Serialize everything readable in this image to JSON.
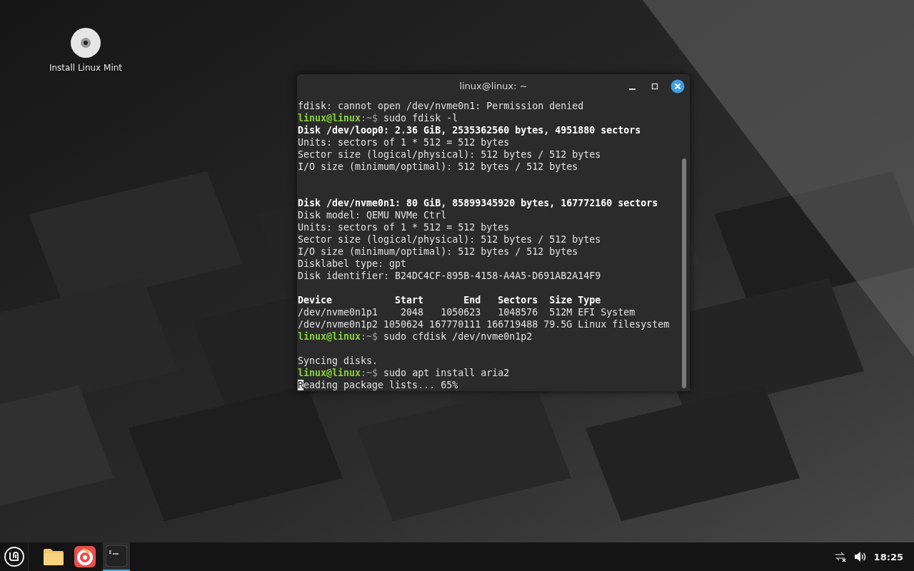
{
  "desktop": {
    "icons": [
      {
        "label": "Install Linux Mint"
      }
    ]
  },
  "terminal": {
    "title": "linux@linux: ~",
    "lines": [
      {
        "kind": "output",
        "text": "fdisk: cannot open /dev/nvme0n1: Permission denied"
      },
      {
        "kind": "prompt",
        "user": "linux@linux",
        "path": ":~$",
        "command": " sudo fdisk -l"
      },
      {
        "kind": "bold",
        "text": "Disk /dev/loop0: 2.36 GiB, 2535362560 bytes, 4951880 sectors"
      },
      {
        "kind": "output",
        "text": "Units: sectors of 1 * 512 = 512 bytes"
      },
      {
        "kind": "output",
        "text": "Sector size (logical/physical): 512 bytes / 512 bytes"
      },
      {
        "kind": "output",
        "text": "I/O size (minimum/optimal): 512 bytes / 512 bytes"
      },
      {
        "kind": "blank"
      },
      {
        "kind": "blank"
      },
      {
        "kind": "bold",
        "text": "Disk /dev/nvme0n1: 80 GiB, 85899345920 bytes, 167772160 sectors"
      },
      {
        "kind": "output",
        "text": "Disk model: QEMU NVMe Ctrl"
      },
      {
        "kind": "output",
        "text": "Units: sectors of 1 * 512 = 512 bytes"
      },
      {
        "kind": "output",
        "text": "Sector size (logical/physical): 512 bytes / 512 bytes"
      },
      {
        "kind": "output",
        "text": "I/O size (minimum/optimal): 512 bytes / 512 bytes"
      },
      {
        "kind": "output",
        "text": "Disklabel type: gpt"
      },
      {
        "kind": "output",
        "text": "Disk identifier: B24DC4CF-895B-4158-A4A5-D691AB2A14F9"
      },
      {
        "kind": "blank"
      },
      {
        "kind": "bold",
        "text": "Device           Start       End   Sectors  Size Type"
      },
      {
        "kind": "output",
        "text": "/dev/nvme0n1p1    2048   1050623   1048576  512M EFI System"
      },
      {
        "kind": "output",
        "text": "/dev/nvme0n1p2 1050624 167770111 166719488 79.5G Linux filesystem"
      },
      {
        "kind": "prompt",
        "user": "linux@linux",
        "path": ":~$",
        "command": " sudo cfdisk /dev/nvme0n1p2"
      },
      {
        "kind": "blank"
      },
      {
        "kind": "output",
        "text": "Syncing disks."
      },
      {
        "kind": "prompt",
        "user": "linux@linux",
        "path": ":~$",
        "command": " sudo apt install aria2"
      },
      {
        "kind": "cursor",
        "cursor_char": "R",
        "text": "eading package lists... 65%"
      }
    ]
  },
  "taskbar": {
    "apps": [
      {
        "kind": "files",
        "selected": false
      },
      {
        "kind": "browser",
        "selected": false
      },
      {
        "kind": "terminal",
        "selected": true
      }
    ],
    "clock": "18:25"
  }
}
